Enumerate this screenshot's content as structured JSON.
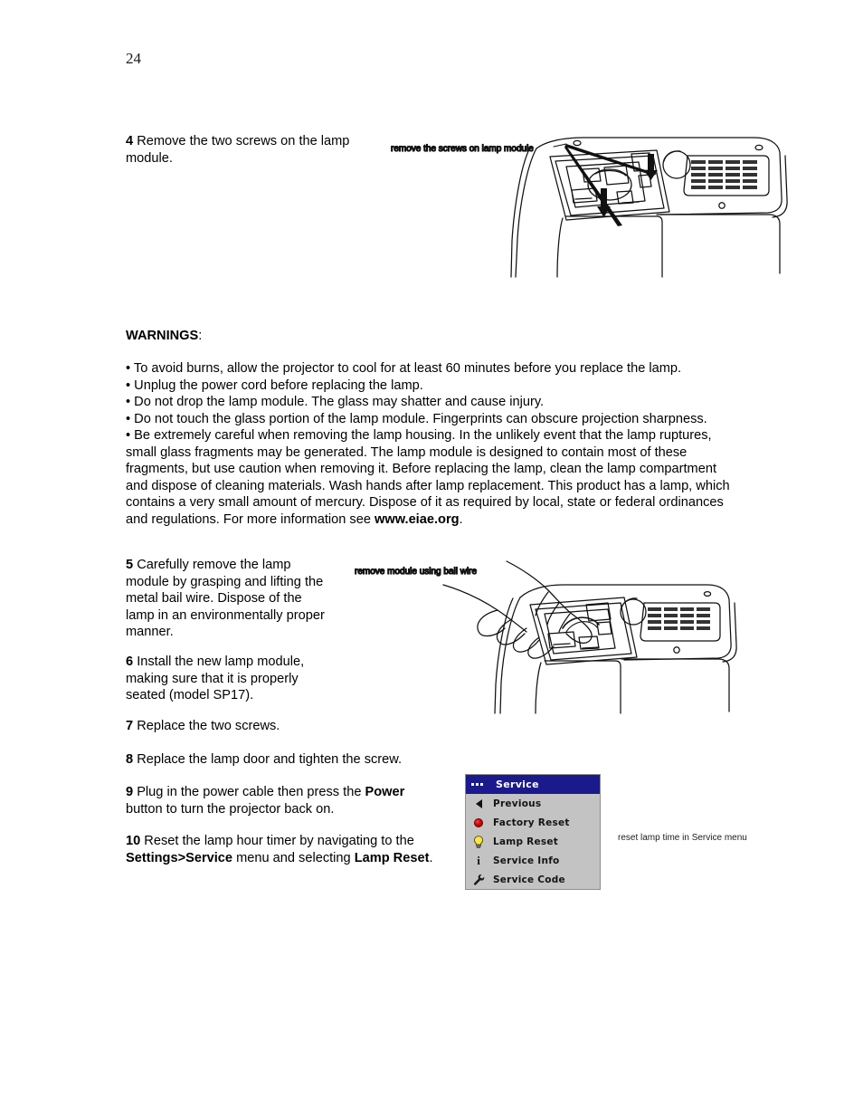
{
  "page": {
    "number": "24"
  },
  "steps": {
    "step4": {
      "num": "4",
      "text": "Remove the two screws on the lamp module."
    },
    "step5": {
      "num": "5",
      "text": "Carefully remove the lamp module by grasping and lifting the metal bail wire. Dispose of the lamp in an environmentally proper manner."
    },
    "step6": {
      "num": "6",
      "text": "Install the new lamp module, making sure that it is properly seated (model SP17)."
    },
    "step7": {
      "num": "7",
      "text": "Replace the two screws."
    },
    "step8": {
      "num": "8",
      "text": "Replace the lamp door and tighten the screw."
    },
    "step9": {
      "num": "9",
      "pre": "Plug in the power cable then press the ",
      "bold": "Power",
      "post": " button to turn the projector back on."
    },
    "step10": {
      "num": "10",
      "pre": "Reset the lamp hour timer by navigating to the ",
      "bold1": "Settings>Service",
      "mid": " menu and selecting ",
      "bold2": "Lamp Reset",
      "post": "."
    }
  },
  "warnings": {
    "heading_bold": "WARNINGS",
    "heading_colon": ":",
    "items": [
      "• To avoid burns, allow the projector to cool for at least 60 minutes before you replace the lamp.",
      "• Unplug the power cord before replacing the lamp.",
      "• Do not drop the lamp module. The glass may shatter and cause injury.",
      "• Do not touch the glass portion of the lamp module. Fingerprints can obscure projection sharpness."
    ],
    "long_item": {
      "pre": "• Be extremely careful when removing the lamp housing. In the unlikely event that the lamp ruptures, small glass fragments may be generated. The lamp module is designed to contain most of these fragments, but use caution when removing it. Before replacing the lamp, clean the lamp compartment and dispose of cleaning materials. Wash hands after lamp replacement. This product has a lamp, which contains a very small amount of mercury. Dispose of it as required by local, state or federal ordinances and regulations. For more information see ",
      "bold": "www.eiae.org",
      "post": "."
    }
  },
  "illustrations": {
    "top": {
      "caption": "remove the screws on lamp module",
      "alt": "top view line drawing of projector with lamp door open, two arrows pointing at screws"
    },
    "middle": {
      "caption": "remove module using bail wire",
      "alt": "top view line drawing of projector with a hand lifting the lamp module by its bail wire"
    }
  },
  "osd_menu": {
    "header_title": "Service",
    "header_bg": "#1a1a8c",
    "body_bg": "#c3c3c3",
    "items": [
      {
        "label": "Previous",
        "icon": "triangle-left-icon"
      },
      {
        "label": "Factory Reset",
        "icon": "red-button-icon"
      },
      {
        "label": "Lamp Reset",
        "icon": "lightbulb-icon"
      },
      {
        "label": "Service Info",
        "icon": "info-icon"
      },
      {
        "label": "Service Code",
        "icon": "wrench-icon"
      }
    ],
    "caption": "reset lamp time in Service menu"
  }
}
